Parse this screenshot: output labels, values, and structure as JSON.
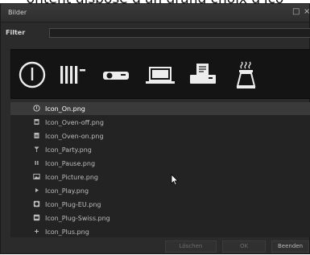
{
  "background": {
    "partial_text": "ontent disposé d'un grand choix d'ico"
  },
  "window": {
    "title": "Bilder",
    "restore_glyph": "□",
    "close_glyph": "×"
  },
  "filter": {
    "label": "Filter",
    "value": ""
  },
  "icon_bar": [
    {
      "icon": "power-icon",
      "selected": true
    },
    {
      "icon": "radiator-icon"
    },
    {
      "icon": "projector-icon"
    },
    {
      "icon": "laptop-icon"
    },
    {
      "icon": "printer-icon"
    },
    {
      "icon": "coffee-maker-icon"
    }
  ],
  "files": [
    {
      "name": "Icon_On.png",
      "icon": "power-icon",
      "selected": true
    },
    {
      "name": "Icon_Oven-off.png",
      "icon": "oven-icon"
    },
    {
      "name": "Icon_Oven-on.png",
      "icon": "oven-on-icon"
    },
    {
      "name": "Icon_Party.png",
      "icon": "party-icon"
    },
    {
      "name": "Icon_Pause.png",
      "icon": "pause-icon"
    },
    {
      "name": "Icon_Picture.png",
      "icon": "picture-icon"
    },
    {
      "name": "Icon_Play.png",
      "icon": "play-icon"
    },
    {
      "name": "Icon_Plug-EU.png",
      "icon": "plug-eu-icon"
    },
    {
      "name": "Icon_Plug-Swiss.png",
      "icon": "plug-swiss-icon"
    },
    {
      "name": "Icon_Plus.png",
      "icon": "plus-icon"
    }
  ],
  "buttons": {
    "delete": "Löschen",
    "ok": "OK",
    "exit": "Beenden"
  },
  "colors": {
    "window_bg": "#2b2b2b",
    "icon_bar_bg": "#141414",
    "selected_row": "#3a3a3a",
    "text": "#bcbcbc"
  }
}
